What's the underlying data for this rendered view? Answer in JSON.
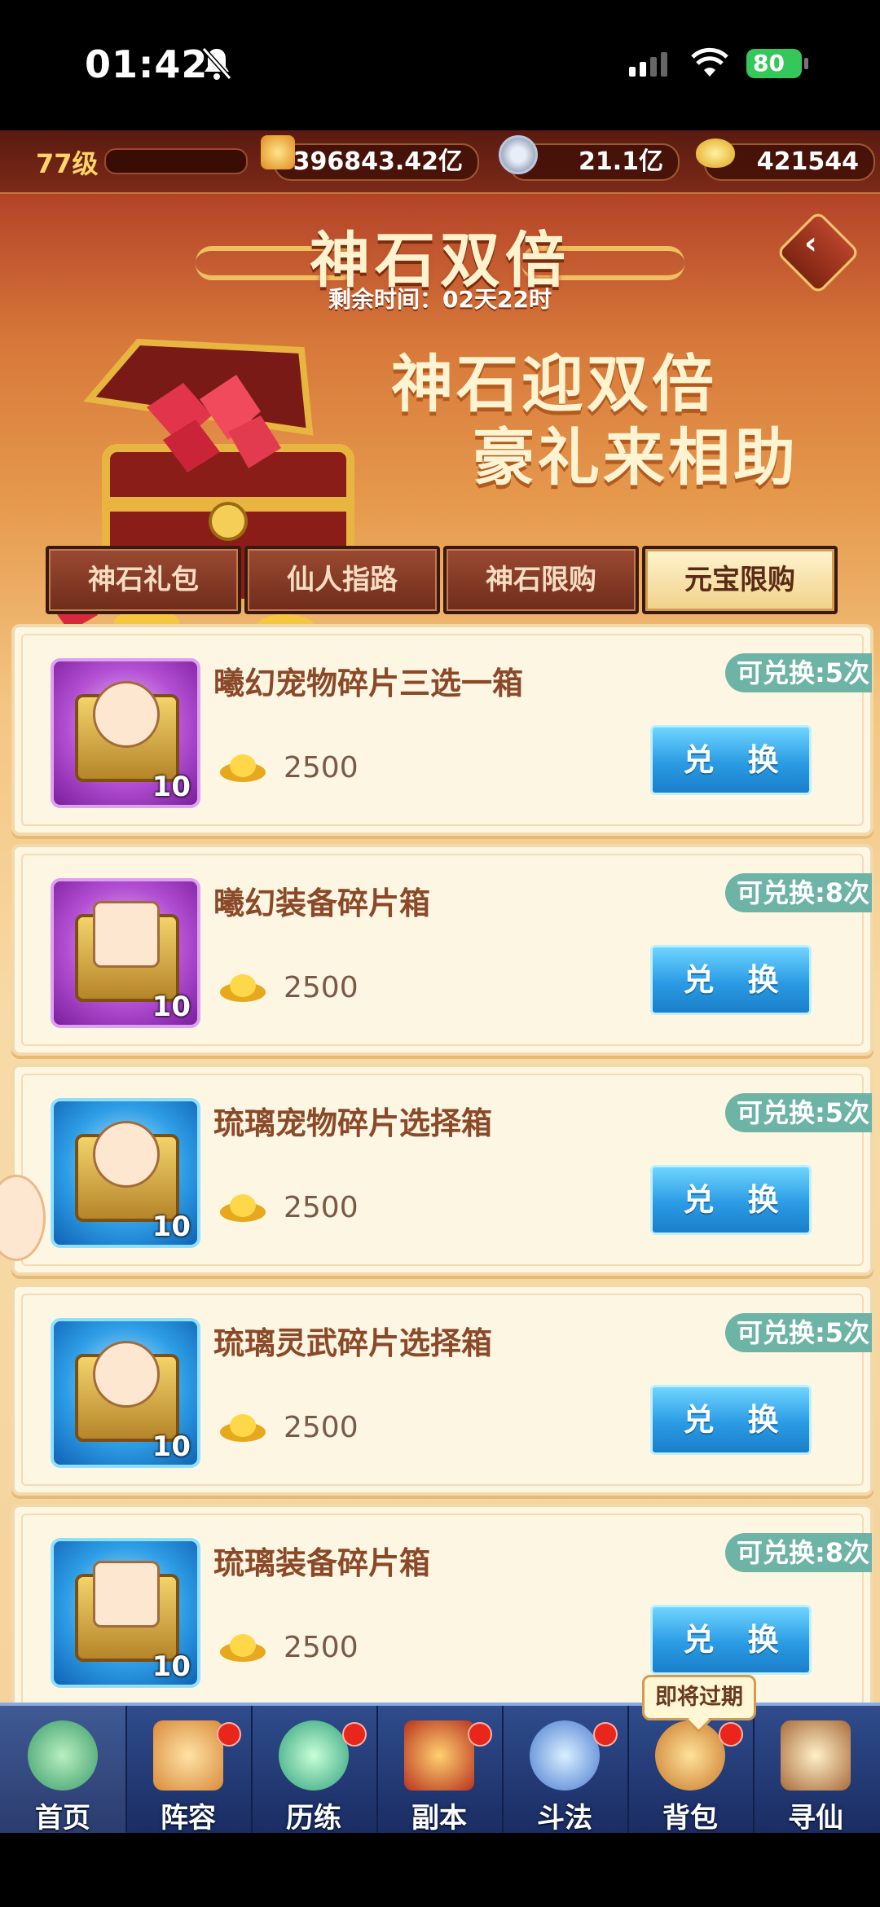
{
  "status_bar": {
    "time": "01:42",
    "battery": "80",
    "icons": [
      "bell-slash-icon",
      "cellular-signal-icon",
      "wifi-icon",
      "battery-charging-icon"
    ]
  },
  "top_bar": {
    "level": "77级",
    "power": "396843.42亿",
    "silver": "21.1亿",
    "gold": "421544"
  },
  "banner": {
    "title": "神石双倍",
    "remaining": "剩余时间：02天22时",
    "slogan_line1": "神石迎双倍",
    "slogan_line2": "豪礼来相助"
  },
  "tabs": [
    {
      "label": "神石礼包",
      "active": false
    },
    {
      "label": "仙人指路",
      "active": false
    },
    {
      "label": "神石限购",
      "active": false
    },
    {
      "label": "元宝限购",
      "active": true
    }
  ],
  "items": [
    {
      "name": "曦幻宠物碎片三选一箱",
      "count": "10",
      "price": "2500",
      "limit": "可兑换:5次",
      "button": "兑 换",
      "theme": "purple"
    },
    {
      "name": "曦幻装备碎片箱",
      "count": "10",
      "price": "2500",
      "limit": "可兑换:8次",
      "button": "兑 换",
      "theme": "purple"
    },
    {
      "name": "琉璃宠物碎片选择箱",
      "count": "10",
      "price": "2500",
      "limit": "可兑换:5次",
      "button": "兑 换",
      "theme": "blue"
    },
    {
      "name": "琉璃灵武碎片选择箱",
      "count": "10",
      "price": "2500",
      "limit": "可兑换:5次",
      "button": "兑 换",
      "theme": "blue"
    },
    {
      "name": "琉璃装备碎片箱",
      "count": "10",
      "price": "2500",
      "limit": "可兑换:8次",
      "button": "兑 换",
      "theme": "blue"
    }
  ],
  "tooltip": "即将过期",
  "nav": [
    {
      "label": "首页",
      "dot": false
    },
    {
      "label": "阵容",
      "dot": true
    },
    {
      "label": "历练",
      "dot": true
    },
    {
      "label": "副本",
      "dot": true
    },
    {
      "label": "斗法",
      "dot": true
    },
    {
      "label": "背包",
      "dot": true
    },
    {
      "label": "寻仙",
      "dot": false
    }
  ],
  "colors": {
    "accent_blue": "#2a9be4",
    "badge_teal": "#6db3a6",
    "title_cream": "#fff3cf",
    "item_name_brown": "#8a4a2a",
    "nav_blue": "#2f4c8c"
  }
}
